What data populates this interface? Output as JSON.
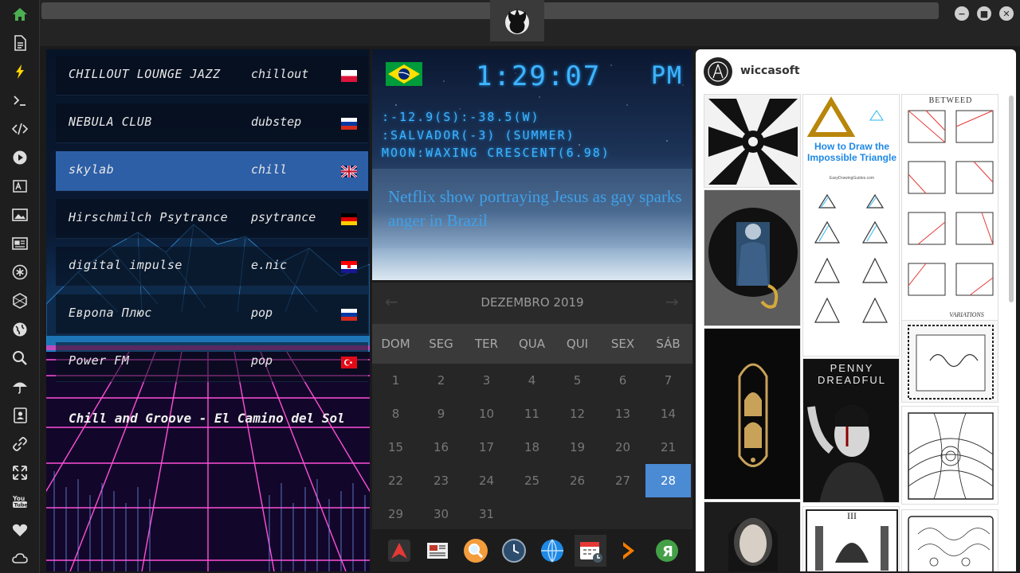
{
  "window": {
    "minimize_icon": "minimize-icon",
    "maximize_icon": "maximize-icon",
    "close_icon": "close-icon"
  },
  "radio": {
    "stations": [
      {
        "name": "CHILLOUT LOUNGE JAZZ",
        "genre": "chillout",
        "flag": "poland"
      },
      {
        "name": "NEBULA CLUB",
        "genre": "dubstep",
        "flag": "russia"
      },
      {
        "name": "skylab",
        "genre": "chill",
        "flag": "uk",
        "active": true
      },
      {
        "name": "Hirschmilch Psytrance",
        "genre": "psytrance",
        "flag": "germany"
      },
      {
        "name": "digital impulse",
        "genre": "e.nic",
        "flag": "croatia"
      },
      {
        "name": "Европа Плюс",
        "genre": "pop",
        "flag": "russia"
      },
      {
        "name": "Power FM",
        "genre": "pop",
        "flag": "turkey"
      }
    ],
    "now_playing": "Chill and Groove - El Camino del Sol"
  },
  "clock": {
    "time": "1:29:07",
    "ampm": "PM",
    "coords": ":-12.9(S):-38.5(W)",
    "location": ":SALVADOR(-3) (SUMMER)",
    "moon": "MOON:WAXING CRESCENT(6.98)",
    "headline": "Netflix show portraying Jesus as gay sparks anger in Brazil"
  },
  "calendar": {
    "title": "DEZEMBRO 2019",
    "weekdays": [
      "DOM",
      "SEG",
      "TER",
      "QUA",
      "QUI",
      "SEX",
      "SÁB"
    ],
    "today": "28",
    "days": [
      "1",
      "2",
      "3",
      "4",
      "5",
      "6",
      "7",
      "8",
      "9",
      "10",
      "11",
      "12",
      "13",
      "14",
      "15",
      "16",
      "17",
      "18",
      "19",
      "20",
      "21",
      "22",
      "23",
      "24",
      "25",
      "26",
      "27",
      "28",
      "29",
      "30",
      "31"
    ]
  },
  "pinterest": {
    "user": "wiccasoft",
    "pin_triangle_title": "How to Draw the Impossible Triangle",
    "pin_triangle_site": "EasyDrawingGuides.com",
    "pin_betweed_title": "BETWEED",
    "pin_variations": "VARIATIONS",
    "pin_penny_title": "PENNY DREADFUL",
    "pin_tarot_numeral": "III"
  },
  "colors": {
    "accent": "#4b8bd4",
    "lcd": "#3fb4ff",
    "active_station": "#2d5fa6"
  }
}
